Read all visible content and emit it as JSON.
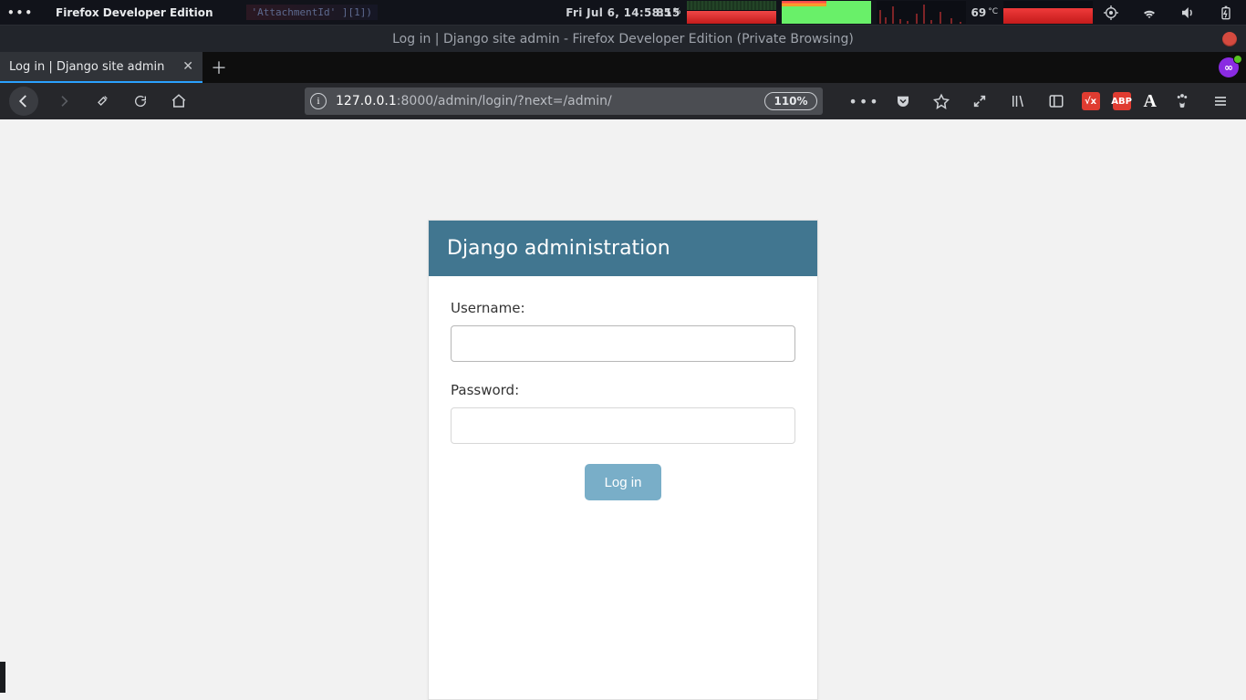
{
  "os": {
    "app_title": "Firefox Developer Edition",
    "scratch_text": "'AttachmentId' ][1])",
    "clock": "Fri Jul  6, 14:58:15",
    "battery_pct_num": "85",
    "battery_pct_sym": "%",
    "temp_num": "69",
    "temp_unit": "°C"
  },
  "window": {
    "title": "Log in | Django site admin - Firefox Developer Edition (Private Browsing)"
  },
  "tab": {
    "title": "Log in | Django site admin"
  },
  "url": {
    "host": "127.0.0.1",
    "rest": ":8000/admin/login/?next=/admin/",
    "zoom": "110%"
  },
  "ext": {
    "badge1": "√x",
    "badge2": "ABP"
  },
  "page": {
    "header": "Django administration",
    "username_label": "Username:",
    "password_label": "Password:",
    "login_label": "Log in"
  }
}
